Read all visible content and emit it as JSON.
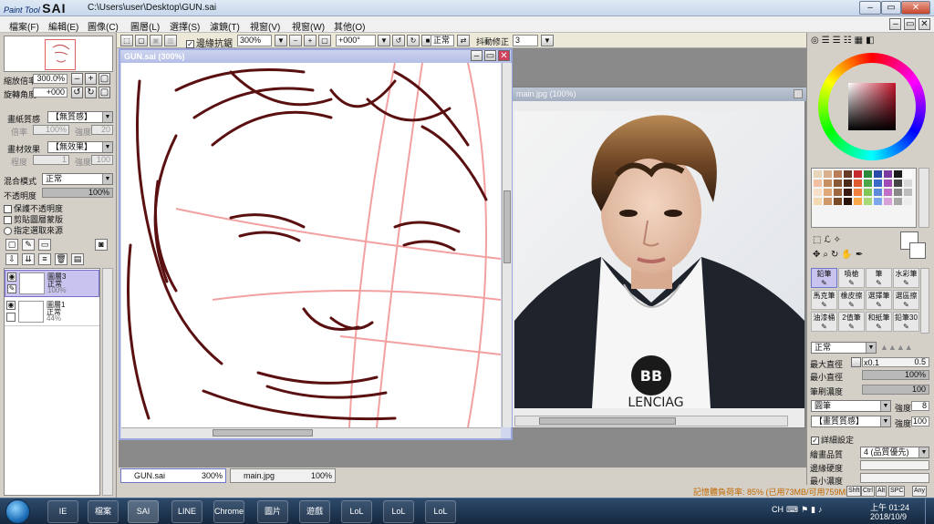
{
  "title_bar": {
    "logo_small": "Paint Tool",
    "logo_big": "SAI",
    "path": "C:\\Users\\user\\Desktop\\GUN.sai"
  },
  "menu": [
    "檔案(F)",
    "編輯(E)",
    "圖像(C)",
    "圖層(L)",
    "選擇(S)",
    "濾鏡(T)",
    "視窗(V)",
    "視窗(W)",
    "其他(O)"
  ],
  "left_panel": {
    "zoom_label": "縮放倍率",
    "zoom_value": "300.0%",
    "rotate_label": "旋轉角度",
    "rotate_value": "+000",
    "paper_texture_label": "畫紙質感",
    "paper_texture_value": "【無質感】",
    "paper_texture_scale_label": "倍率",
    "paper_texture_scale_value": "100%",
    "paper_texture_strength_label": "強度",
    "paper_texture_strength_value": "20",
    "material_effect_label": "畫材效果",
    "material_effect_value": "【無效果】",
    "material_degree_label": "程度",
    "material_degree_value": "1",
    "material_strength_label": "強度",
    "material_strength_value": "100",
    "blend_mode_label": "混合模式",
    "blend_mode_value": "正常",
    "opacity_label": "不透明度",
    "opacity_value": "100%",
    "checks": [
      "保護不透明度",
      "剪貼圖層蒙版",
      "指定選取來源"
    ],
    "layers": [
      {
        "name": "圖層3",
        "mode": "正常",
        "opacity": "100%",
        "selected": true
      },
      {
        "name": "圖層1",
        "mode": "正常",
        "opacity": "44%",
        "selected": false
      }
    ]
  },
  "toolbar": {
    "antialias_label": "邊緣抗鋸",
    "zoom_value": "300%",
    "angle_value": "+000°",
    "mode_value": "正常",
    "stabilizer_label": "抖動修正",
    "stabilizer_value": "3"
  },
  "canvas": {
    "draw_window_title": "GUN.sai (300%)",
    "ref_window_title": "main.jpg (100%)",
    "shirt_logo": "BB",
    "shirt_text": "LENCIAG"
  },
  "doc_tabs": [
    {
      "name": "GUN.sai",
      "zoom": "300%"
    },
    {
      "name": "main.jpg",
      "zoom": "100%"
    }
  ],
  "right_panel": {
    "palette_colors": [
      "#e8d4b8",
      "#d8b08c",
      "#b87c58",
      "#6a3a28",
      "#c42a30",
      "#2a8a3a",
      "#2a4aa8",
      "#7a3aa0",
      "#1a1a1a",
      "#fafafa",
      "#f0c0a0",
      "#c89060",
      "#8a5a38",
      "#4a2a18",
      "#e05a30",
      "#4aa848",
      "#3a6ac8",
      "#a04ab8",
      "#444444",
      "#d8d8d8",
      "#f8e0c8",
      "#e0a878",
      "#a06840",
      "#3a1a10",
      "#f08040",
      "#80c858",
      "#5a8ad8",
      "#c070c8",
      "#888888",
      "#bcbcbc",
      "#f4d8b0",
      "#d09868",
      "#7a4a28",
      "#2a1208",
      "#f8a848",
      "#a8d878",
      "#7aa8e8",
      "#d8a0d8",
      "#a8a8a8",
      "#ececec"
    ],
    "brushes": [
      [
        "鉛筆",
        "噴槍",
        "筆",
        "水彩筆"
      ],
      [
        "馬克筆",
        "橡皮擦",
        "選擇筆",
        "選區擦"
      ],
      [
        "油漆桶",
        "2值筆",
        "和紙筆",
        "鉛筆30"
      ]
    ],
    "brush_mode_value": "正常",
    "max_size_label": "最大直徑",
    "max_size_mult": "x0.1",
    "max_size_value": "0.5",
    "min_size_label": "最小直徑",
    "min_size_value": "100%",
    "density_label": "筆刷濃度",
    "density_value": "100",
    "brush_shape_value": "圓筆",
    "brush_shape_strength_label": "強度",
    "brush_shape_strength_value": "8",
    "brush_texture_value": "【畫質質感】",
    "brush_texture_strength_label": "強度",
    "brush_texture_strength_value": "100",
    "detail_label": "詳細設定",
    "quality_label": "繪畫品質",
    "quality_value": "4 (品質優先)",
    "edge_hardness_label": "邊緣硬度",
    "min_density_label": "最小濃度"
  },
  "status": {
    "memory": "記憶體負荷率: 85% (已用73MB/可用759MB)",
    "keys": [
      "Shft",
      "Ctrl",
      "Alt",
      "SPC",
      "Any"
    ]
  },
  "taskbar": {
    "apps": [
      "IE",
      "檔案",
      "SAI",
      "LINE",
      "Chrome",
      "圖片",
      "遊戲",
      "LoL",
      "LoL",
      "LoL"
    ],
    "tray_lang": "CH",
    "time": "上午 01:24",
    "date": "2018/10/9"
  }
}
